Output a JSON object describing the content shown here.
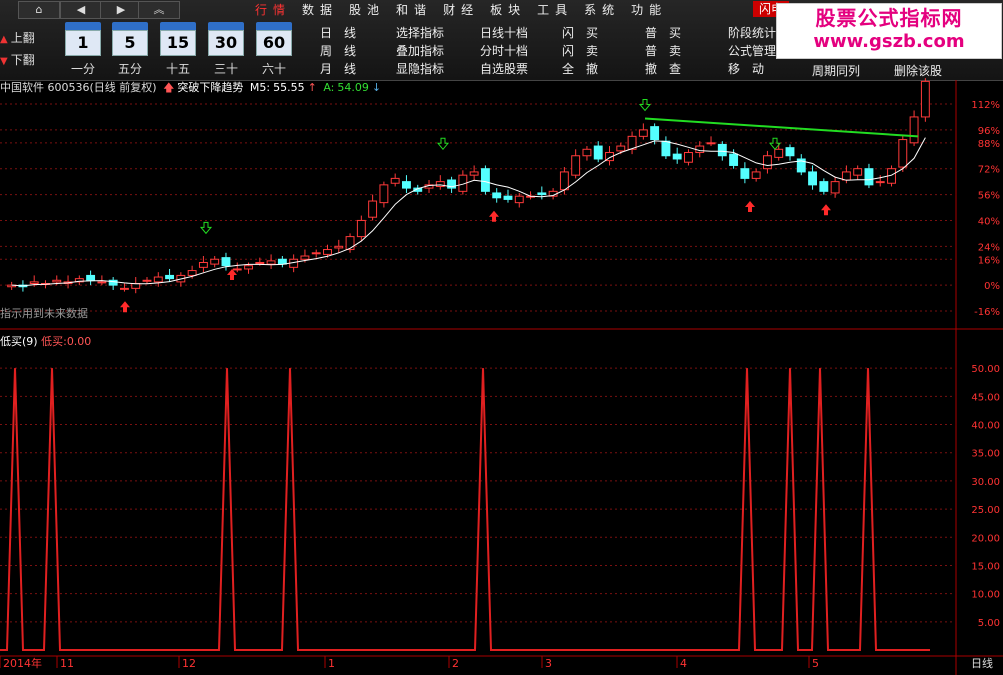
{
  "nav": {
    "home_icon": "home-icon",
    "back_icon": "triangle-left-icon",
    "forward_icon": "triangle-right-icon",
    "collapse_icon": "double-chevron-up-icon"
  },
  "menu": [
    {
      "label": "行情",
      "active": true
    },
    {
      "label": "数据",
      "active": false
    },
    {
      "label": "股池",
      "active": false
    },
    {
      "label": "和谐",
      "active": false
    },
    {
      "label": "财经",
      "active": false
    },
    {
      "label": "板块",
      "active": false
    },
    {
      "label": "工具",
      "active": false
    },
    {
      "label": "系统",
      "active": false
    },
    {
      "label": "功能",
      "active": false
    }
  ],
  "flash_label": "闪电",
  "pager": {
    "up": "上翻",
    "down": "下翻"
  },
  "periods": [
    {
      "num": "1",
      "label": "一分"
    },
    {
      "num": "5",
      "label": "五分"
    },
    {
      "num": "15",
      "label": "十五"
    },
    {
      "num": "30",
      "label": "三十"
    },
    {
      "num": "60",
      "label": "六十"
    }
  ],
  "quick_buttons": [
    [
      "日　线",
      "选择指标",
      "日线十档",
      "闪　买",
      "普　买",
      "阶段统计"
    ],
    [
      "周　线",
      "叠加指标",
      "分时十档",
      "闪　卖",
      "普　卖",
      "公式管理"
    ],
    [
      "月　线",
      "显隐指标",
      "自选股票",
      "全　撤",
      "撤　查",
      "移　动"
    ]
  ],
  "promo": {
    "title": "股票公式指标网",
    "url": "www.gszb.com",
    "under_left": "周期同列",
    "under_right": "删除该股"
  },
  "info": {
    "stock": "中国软件 600536(日线 前复权)",
    "signal": "突破下降趋势",
    "m5_label": "M5:",
    "m5_value": "55.55",
    "a_label": "A:",
    "a_value": "54.09",
    "future_note": "指示用到未来数据"
  },
  "main_axis_labels": [
    "112%",
    "96%",
    "88%",
    "72%",
    "56%",
    "40%",
    "24%",
    "16%",
    "0%",
    "-16%"
  ],
  "sub": {
    "indicator": "低买(9)",
    "value_label": "低买:",
    "value": "0.00",
    "axis_labels": [
      "50.00",
      "45.00",
      "40.00",
      "35.00",
      "30.00",
      "25.00",
      "20.00",
      "15.00",
      "10.00",
      "5.00"
    ]
  },
  "dates": [
    "2014年",
    "11",
    "12",
    "1",
    "2",
    "3",
    "4",
    "5"
  ],
  "period_label": "日线",
  "colors": {
    "up": "#ff3a3a",
    "down": "#54ffff",
    "ma": "#ffffff",
    "trend": "#22dd22",
    "grid": "#7a1010",
    "indicator": "#e02020"
  },
  "chart_data": [
    {
      "type": "candlestick",
      "title": "中国软件 600536(日线 前复权)",
      "y_axis_unit": "%",
      "ylim": [
        -16,
        112
      ],
      "close_series_pct": [
        0,
        -1,
        2,
        1,
        3,
        2,
        4,
        3,
        2,
        0,
        -2,
        1,
        3,
        5,
        4,
        6,
        9,
        14,
        16,
        12,
        10,
        12,
        14,
        15,
        13,
        16,
        18,
        20,
        22,
        24,
        30,
        40,
        52,
        62,
        66,
        60,
        58,
        62,
        64,
        60,
        68,
        70,
        58,
        54,
        53,
        55,
        55,
        56,
        58,
        70,
        80,
        84,
        78,
        82,
        86,
        92,
        96,
        90,
        80,
        78,
        82,
        86,
        88,
        80,
        74,
        66,
        70,
        80,
        84,
        80,
        70,
        62,
        58,
        64,
        70,
        72,
        62,
        64,
        72,
        90,
        104,
        126
      ],
      "ma_label": "M5",
      "trend_line": {
        "from_pct": 103,
        "to_pct": 92
      }
    },
    {
      "type": "line",
      "title": "低买(9)",
      "ylim": [
        0,
        55
      ],
      "series": [
        {
          "name": "低买",
          "spikes": 11,
          "peak": 50,
          "base": 0
        }
      ]
    }
  ]
}
